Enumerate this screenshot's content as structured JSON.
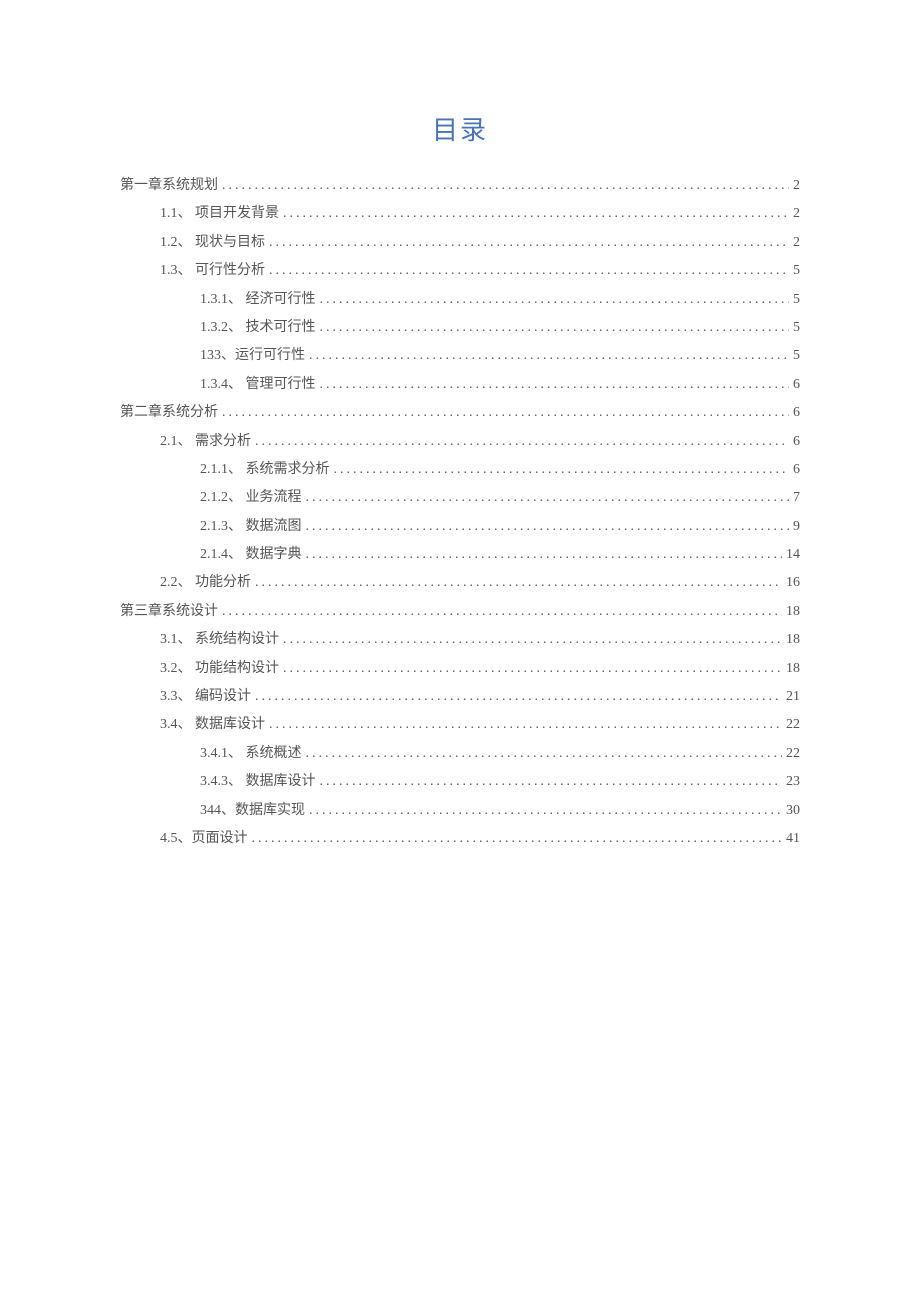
{
  "title": "目录",
  "entries": [
    {
      "label": "第一章系统规划",
      "page": "2",
      "level": 0
    },
    {
      "label": "1.1、 项目开发背景",
      "page": "2",
      "level": 1
    },
    {
      "label": "1.2、 现状与目标",
      "page": "2",
      "level": 1
    },
    {
      "label": "1.3、 可行性分析",
      "page": "5",
      "level": 1
    },
    {
      "label": "1.3.1、 经济可行性",
      "page": "5",
      "level": 2
    },
    {
      "label": "1.3.2、 技术可行性",
      "page": "5",
      "level": 2
    },
    {
      "label": "133、运行可行性",
      "page": "5",
      "level": 2
    },
    {
      "label": "1.3.4、 管理可行性",
      "page": "6",
      "level": 2
    },
    {
      "label": "第二章系统分析",
      "page": "6",
      "level": 0
    },
    {
      "label": "2.1、 需求分析",
      "page": "6",
      "level": 1
    },
    {
      "label": "2.1.1、 系统需求分析",
      "page": "6",
      "level": 2
    },
    {
      "label": "2.1.2、 业务流程",
      "page": "7",
      "level": 2
    },
    {
      "label": "2.1.3、 数据流图",
      "page": "9",
      "level": 2
    },
    {
      "label": "2.1.4、 数据字典",
      "page": "14",
      "level": 2
    },
    {
      "label": "2.2、 功能分析",
      "page": "16",
      "level": 1
    },
    {
      "label": "第三章系统设计",
      "page": "18",
      "level": 0
    },
    {
      "label": "3.1、 系统结构设计",
      "page": "18",
      "level": 1
    },
    {
      "label": "3.2、 功能结构设计",
      "page": "18",
      "level": 1
    },
    {
      "label": "3.3、 编码设计",
      "page": "21",
      "level": 1
    },
    {
      "label": "3.4、 数据库设计",
      "page": "22",
      "level": 1
    },
    {
      "label": "3.4.1、 系统概述",
      "page": "22",
      "level": 2
    },
    {
      "label": "3.4.3、 数据库设计",
      "page": "23",
      "level": 2
    },
    {
      "label": "344、数据库实现",
      "page": "30",
      "level": 2
    },
    {
      "label": "4.5、页面设计",
      "page": "41",
      "level": 1
    }
  ]
}
